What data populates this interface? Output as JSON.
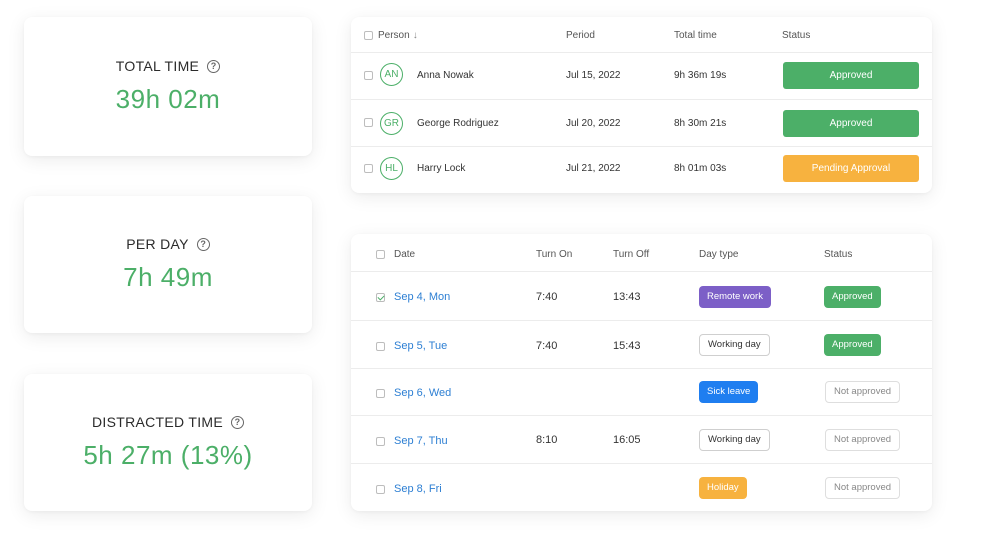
{
  "stats": [
    {
      "label": "TOTAL TIME",
      "value": "39h 02m"
    },
    {
      "label": "PER DAY",
      "value": "7h 49m"
    },
    {
      "label": "DISTRACTED TIME",
      "value": "5h 27m (13%)"
    }
  ],
  "approvals": {
    "headers": {
      "person": "Person",
      "period": "Period",
      "total": "Total time",
      "status": "Status"
    },
    "rows": [
      {
        "initials": "AN",
        "name": "Anna Nowak",
        "period": "Jul 15, 2022",
        "total": "9h 36m 19s",
        "status": "Approved",
        "status_color": "#4caf68"
      },
      {
        "initials": "GR",
        "name": "George Rodriguez",
        "period": "Jul 20, 2022",
        "total": "8h 30m 21s",
        "status": "Approved",
        "status_color": "#4caf68"
      },
      {
        "initials": "HL",
        "name": "Harry Lock",
        "period": "Jul 21, 2022",
        "total": "8h 01m 03s",
        "status": "Pending Approval",
        "status_color": "#f7b23f"
      }
    ]
  },
  "days": {
    "headers": {
      "date": "Date",
      "on": "Turn On",
      "off": "Turn Off",
      "type": "Day type",
      "status": "Status"
    },
    "rows": [
      {
        "date": "Sep 4, Mon",
        "on": "7:40",
        "off": "13:43",
        "type": "Remote work",
        "status": "Approved"
      },
      {
        "date": "Sep 5, Tue",
        "on": "7:40",
        "off": "15:43",
        "type": "Working day",
        "status": "Approved"
      },
      {
        "date": "Sep 6, Wed",
        "on": "",
        "off": "",
        "type": "Sick leave",
        "status": "Not approved"
      },
      {
        "date": "Sep 7, Thu",
        "on": "8:10",
        "off": "16:05",
        "type": "Working day",
        "status": "Not approved"
      },
      {
        "date": "Sep 8, Fri",
        "on": "",
        "off": "",
        "type": "Holiday",
        "status": "Not approved"
      }
    ]
  },
  "colors": {
    "green": "#4caf68",
    "orange": "#f7b23f",
    "purple": "#7c5fc7",
    "blue": "#2d7fd3",
    "sick_blue": "#1f7ef0"
  }
}
